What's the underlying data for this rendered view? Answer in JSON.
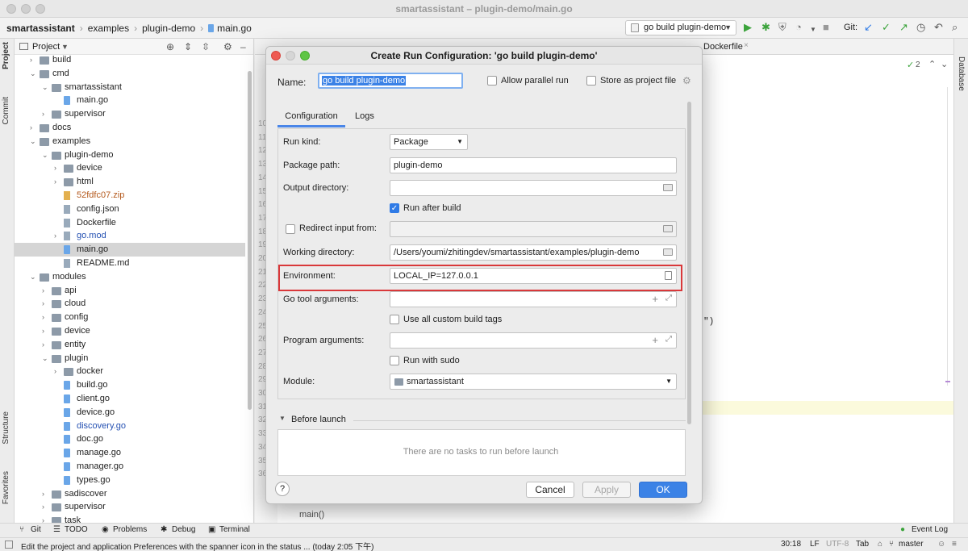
{
  "window": {
    "title": "smartassistant – plugin-demo/main.go"
  },
  "breadcrumb": [
    "smartassistant",
    "examples",
    "plugin-demo",
    "main.go"
  ],
  "toolbar": {
    "run_config": "go build plugin-demo",
    "git_label": "Git:"
  },
  "left_strip": {
    "project": "Project",
    "commit": "Commit",
    "structure": "Structure",
    "favorites": "Favorites"
  },
  "right_strip": {
    "database": "Database"
  },
  "project_panel": {
    "title": "Project",
    "tree": [
      {
        "label": "build",
        "depth": 1,
        "kind": "folder",
        "arrow": "›"
      },
      {
        "label": "cmd",
        "depth": 1,
        "kind": "folder",
        "arrow": "⌄"
      },
      {
        "label": "smartassistant",
        "depth": 2,
        "kind": "folder",
        "arrow": "⌄"
      },
      {
        "label": "main.go",
        "depth": 3,
        "kind": "file"
      },
      {
        "label": "supervisor",
        "depth": 2,
        "kind": "folder",
        "arrow": "›"
      },
      {
        "label": "docs",
        "depth": 1,
        "kind": "folder",
        "arrow": "›"
      },
      {
        "label": "examples",
        "depth": 1,
        "kind": "folder",
        "arrow": "⌄"
      },
      {
        "label": "plugin-demo",
        "depth": 2,
        "kind": "folder",
        "arrow": "⌄"
      },
      {
        "label": "device",
        "depth": 3,
        "kind": "folder",
        "arrow": "›"
      },
      {
        "label": "html",
        "depth": 3,
        "kind": "folder",
        "arrow": "›"
      },
      {
        "label": "52fdfc07.zip",
        "depth": 3,
        "kind": "zip",
        "color": "orange"
      },
      {
        "label": "config.json",
        "depth": 3,
        "kind": "doc"
      },
      {
        "label": "Dockerfile",
        "depth": 3,
        "kind": "doc"
      },
      {
        "label": "go.mod",
        "depth": 3,
        "kind": "doc",
        "color": "blue",
        "arrow": "›"
      },
      {
        "label": "main.go",
        "depth": 3,
        "kind": "file",
        "selected": true
      },
      {
        "label": "README.md",
        "depth": 3,
        "kind": "doc"
      },
      {
        "label": "modules",
        "depth": 1,
        "kind": "folder",
        "arrow": "⌄"
      },
      {
        "label": "api",
        "depth": 2,
        "kind": "folder",
        "arrow": "›"
      },
      {
        "label": "cloud",
        "depth": 2,
        "kind": "folder",
        "arrow": "›"
      },
      {
        "label": "config",
        "depth": 2,
        "kind": "folder",
        "arrow": "›"
      },
      {
        "label": "device",
        "depth": 2,
        "kind": "folder",
        "arrow": "›"
      },
      {
        "label": "entity",
        "depth": 2,
        "kind": "folder",
        "arrow": "›"
      },
      {
        "label": "plugin",
        "depth": 2,
        "kind": "folder",
        "arrow": "⌄"
      },
      {
        "label": "docker",
        "depth": 3,
        "kind": "folder",
        "arrow": "›"
      },
      {
        "label": "build.go",
        "depth": 3,
        "kind": "file"
      },
      {
        "label": "client.go",
        "depth": 3,
        "kind": "file"
      },
      {
        "label": "device.go",
        "depth": 3,
        "kind": "file"
      },
      {
        "label": "discovery.go",
        "depth": 3,
        "kind": "file",
        "color": "blue"
      },
      {
        "label": "doc.go",
        "depth": 3,
        "kind": "file"
      },
      {
        "label": "manage.go",
        "depth": 3,
        "kind": "file"
      },
      {
        "label": "manager.go",
        "depth": 3,
        "kind": "file"
      },
      {
        "label": "types.go",
        "depth": 3,
        "kind": "file"
      },
      {
        "label": "sadiscover",
        "depth": 2,
        "kind": "folder",
        "arrow": "›"
      },
      {
        "label": "supervisor",
        "depth": 2,
        "kind": "folder",
        "arrow": "›"
      },
      {
        "label": "task",
        "depth": 2,
        "kind": "folder",
        "arrow": "›"
      }
    ]
  },
  "editor": {
    "tab_dockerfile": "Dockerfile",
    "inspection_count": "2",
    "line_numbers": [
      "10",
      "11",
      "12",
      "13",
      "14",
      "15",
      "16",
      "17",
      "18",
      "19",
      "20",
      "21",
      "22",
      "23",
      "24",
      "25",
      "26",
      "27",
      "28",
      "29",
      "30",
      "31",
      "32",
      "33",
      "34",
      "35",
      "36"
    ],
    "footer_text": "main()",
    "paren_fragment": "\")"
  },
  "dialog": {
    "title": "Create Run Configuration: 'go build plugin-demo'",
    "name_label": "Name:",
    "name_value": "go build plugin-demo",
    "allow_parallel": "Allow parallel run",
    "store_as_project": "Store as project file",
    "tabs": [
      "Configuration",
      "Logs"
    ],
    "fields": {
      "run_kind_label": "Run kind:",
      "run_kind_value": "Package",
      "package_path_label": "Package path:",
      "package_path_value": "plugin-demo",
      "output_dir_label": "Output directory:",
      "output_dir_value": "",
      "run_after_build": "Run after build",
      "redirect_input": "Redirect input from:",
      "working_dir_label": "Working directory:",
      "working_dir_value": "/Users/youmi/zhitingdev/smartassistant/examples/plugin-demo",
      "environment_label": "Environment:",
      "environment_value": "LOCAL_IP=127.0.0.1",
      "go_tool_args_label": "Go tool arguments:",
      "use_custom_tags": "Use all custom build tags",
      "program_args_label": "Program arguments:",
      "run_with_sudo": "Run with sudo",
      "module_label": "Module:",
      "module_value": "smartassistant"
    },
    "before_launch": "Before launch",
    "no_tasks": "There are no tasks to run before launch",
    "help": "?",
    "cancel": "Cancel",
    "apply": "Apply",
    "ok": "OK"
  },
  "bottom_tools": [
    "Git",
    "TODO",
    "Problems",
    "Debug",
    "Terminal"
  ],
  "event_log": "Event Log",
  "status": {
    "message": "Edit the project and application Preferences with the spanner icon in the status ... (today 2:05 下午)",
    "position": "30:18",
    "line_sep": "LF",
    "encoding": "UTF-8",
    "indent": "Tab",
    "branch": "master"
  },
  "colors": {
    "accent": "#3b82e6",
    "highlight": "#d9383a"
  }
}
